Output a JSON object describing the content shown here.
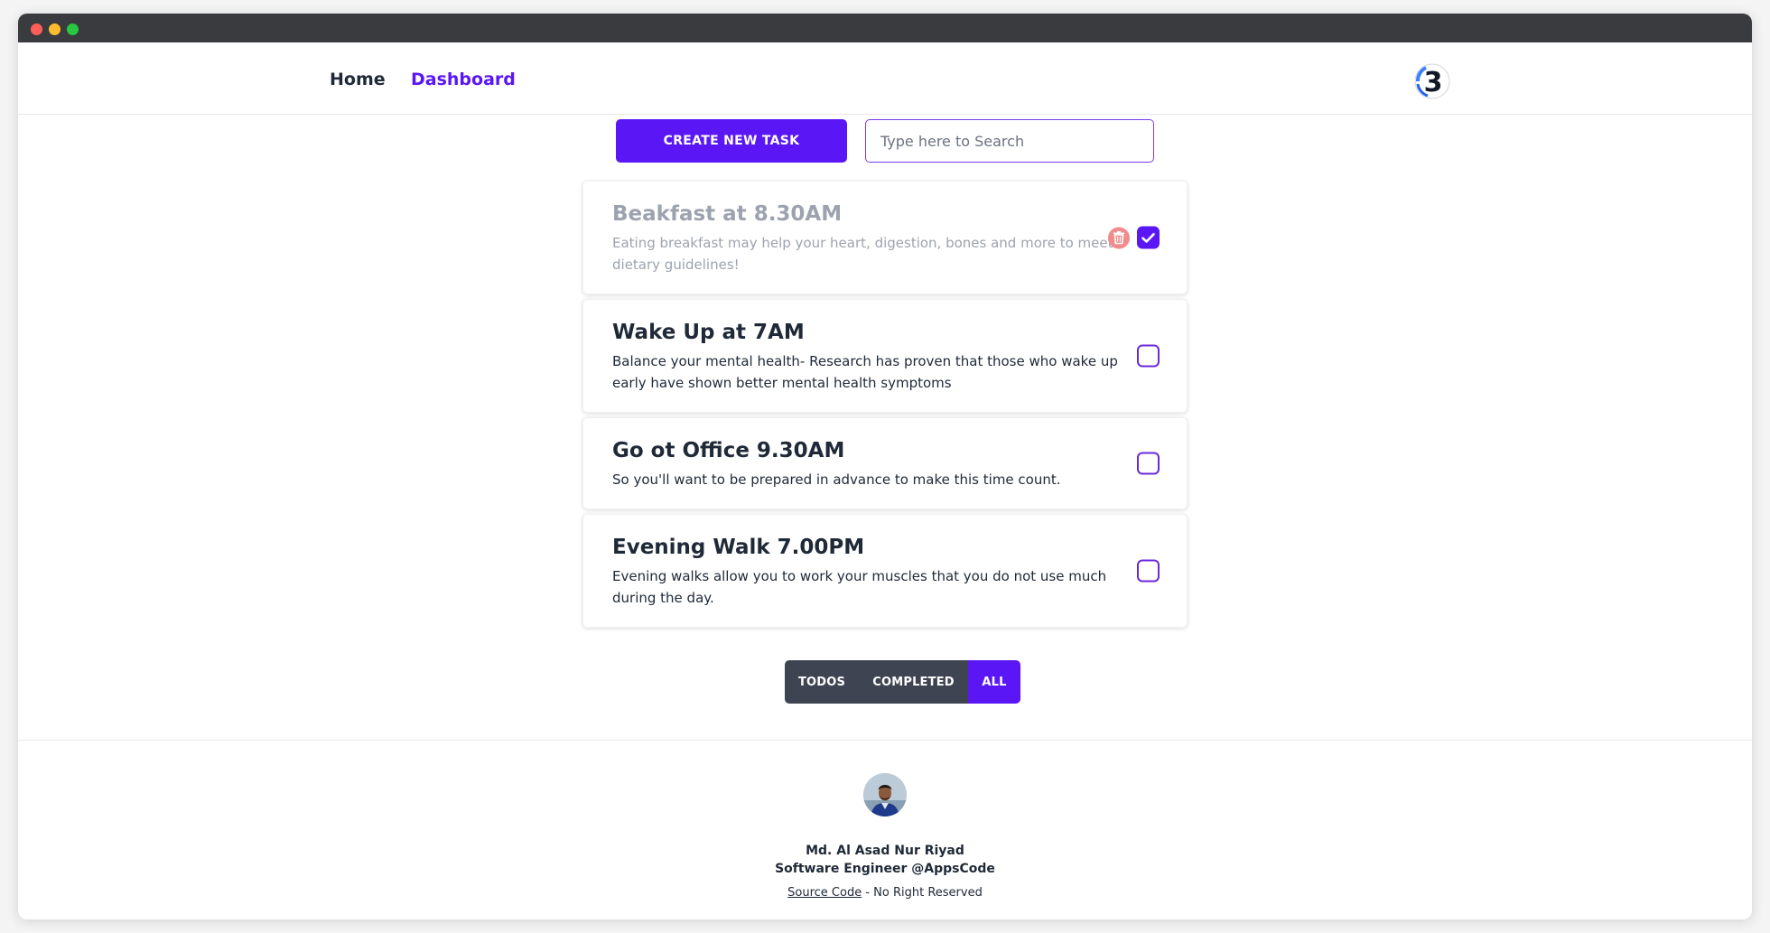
{
  "nav": {
    "home_label": "Home",
    "dashboard_label": "Dashboard",
    "logo_text": "3"
  },
  "toolbar": {
    "create_label": "CREATE NEW TASK",
    "search_placeholder": "Type here to Search",
    "search_value": ""
  },
  "tasks": [
    {
      "title": "Beakfast at 8.30AM",
      "description": "Eating breakfast may help your heart, digestion, bones and more to meet dietary guidelines!",
      "completed": true
    },
    {
      "title": "Wake Up at 7AM",
      "description": "Balance your mental health- Research has proven that those who wake up early have shown better mental health symptoms",
      "completed": false
    },
    {
      "title": "Go ot Office 9.30AM",
      "description": "So you'll want to be prepared in advance to make this time count.",
      "completed": false
    },
    {
      "title": "Evening Walk 7.00PM",
      "description": "Evening walks allow you to work your muscles that you do not use much during the day.",
      "completed": false
    }
  ],
  "filters": {
    "todos_label": "TODOS",
    "completed_label": "COMPLETED",
    "all_label": "ALL",
    "active": "all"
  },
  "footer": {
    "name": "Md. Al Asad Nur Riyad",
    "role": "Software Engineer @AppsCode",
    "source_label": "Source Code",
    "rights_text": " - No Right Reserved"
  },
  "colors": {
    "accent": "#5b16f5",
    "filter_inactive": "#3f4452",
    "trash": "#f28b8b"
  },
  "icons": {
    "trash": "trash-icon",
    "check": "check-icon",
    "logo": "logo-icon"
  }
}
